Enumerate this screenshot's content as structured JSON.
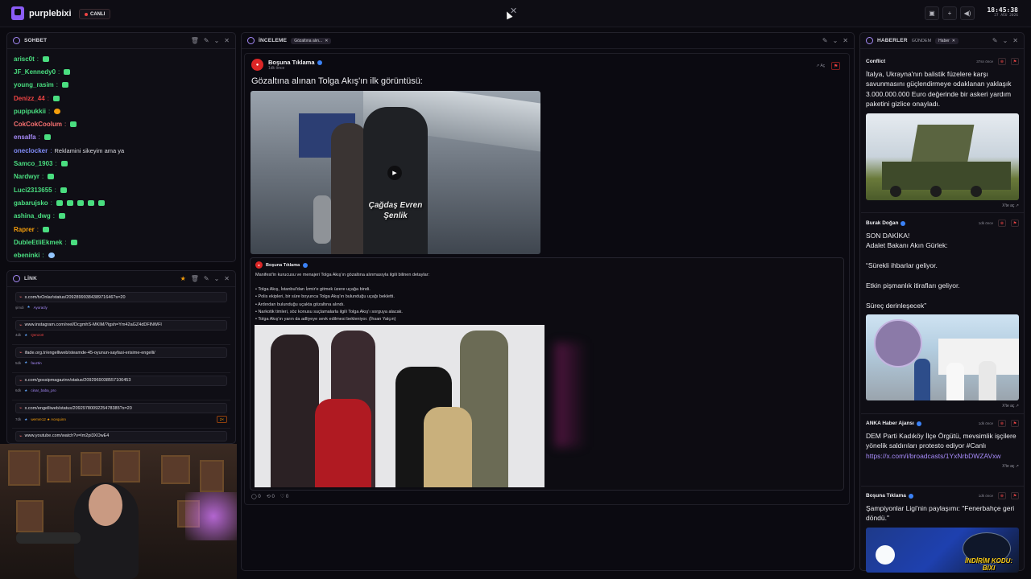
{
  "app": {
    "name": "purplebixi",
    "live_label": "CANLI",
    "time": "18:45:38",
    "date": "27 AĞU 2026"
  },
  "chat": {
    "title": "SOHBET",
    "messages": [
      {
        "user": "arisc0t",
        "color": "#4ade80",
        "msg": "",
        "emotes": 1
      },
      {
        "user": "JF_Kennedy0",
        "color": "#4ade80",
        "msg": "",
        "emotes": 1
      },
      {
        "user": "young_rasim",
        "color": "#4ade80",
        "msg": "",
        "emotes": 1
      },
      {
        "user": "Denizz_44",
        "color": "#ef4444",
        "msg": "",
        "emotes": 1
      },
      {
        "user": "pupipukkii",
        "color": "#4ade80",
        "msg": "",
        "emotes": 1
      },
      {
        "user": "CokCokCoolum",
        "color": "#f87171",
        "msg": "",
        "emotes": 1
      },
      {
        "user": "ensalfa",
        "color": "#a78bfa",
        "msg": "",
        "emotes": 1
      },
      {
        "user": "oneclocker",
        "color": "#818cf8",
        "msg": "Reklamini sikeyim ama ya",
        "emotes": 0
      },
      {
        "user": "Samco_1903",
        "color": "#4ade80",
        "msg": "",
        "emotes": 1
      },
      {
        "user": "Nardwyr",
        "color": "#4ade80",
        "msg": "",
        "emotes": 1
      },
      {
        "user": "Luci2313655",
        "color": "#4ade80",
        "msg": "",
        "emotes": 1
      },
      {
        "user": "gabarujsko",
        "color": "#4ade80",
        "msg": "",
        "emotes": 5
      },
      {
        "user": "ashina_dwg",
        "color": "#4ade80",
        "msg": "",
        "emotes": 1
      },
      {
        "user": "Raprer",
        "color": "#f59e0b",
        "msg": "",
        "emotes": 1
      },
      {
        "user": "DubleEtliEkmek",
        "color": "#4ade80",
        "msg": "",
        "emotes": 1
      },
      {
        "user": "ebeninki",
        "color": "#4ade80",
        "msg": "",
        "emotes": 1
      }
    ]
  },
  "links": {
    "title": "LİNK",
    "items": [
      {
        "url": "x.com/tvOnlar/status/2092899938438971646?s=20",
        "age": "şimdi",
        "by": "Ayoracly",
        "by_color": "#a78bfa",
        "badge": ""
      },
      {
        "url": "www.instagram.com/reel/DcgmhS-MKIM/?igsh=Ym42aGZ4dDFlNWFl",
        "age": "4dk",
        "by": "Qenzo0",
        "by_color": "#ef4444",
        "badge": ""
      },
      {
        "url": "ifade.org.tr/engelliweb/steamde-45-oyunun-sayfasi-erisime-engelli/",
        "age": "5dk",
        "by": "fauztin",
        "by_color": "#a78bfa",
        "badge": ""
      },
      {
        "url": "x.com/gossipmagazinn/status/2092969038557106453",
        "age": "6dk",
        "by": "cinar_baba_pro",
        "by_color": "#a78bfa",
        "badge": ""
      },
      {
        "url": "x.com/engelliweb/status/2092978009225478385?s=20",
        "age": "7dk",
        "by": "wemre12 ★ Acequinn",
        "by_color": "#f59e0b",
        "badge": "2×"
      },
      {
        "url": "www.youtube.com/watch?v=Im2pi3XOwE4",
        "age": "",
        "by": "",
        "by_color": "#a78bfa",
        "badge": ""
      }
    ]
  },
  "review": {
    "title": "İNCELEME",
    "chip": "Gözaltına alın...",
    "author": "Boşuna Tıklama",
    "time": "1dk önce",
    "text": "Gözaltına alınan Tolga Akış'ın ilk görüntüsü:",
    "open_label": "Aç",
    "video_caption": "Çağdaş Evren Şenlik",
    "quote_author": "Boşuna Tıklama",
    "quote_lines": [
      "Manifest'in kurucusu ve menajeri Tolga Akış'ın gözaltına alınmasıyla ilgili bilinen detaylar:",
      "",
      "• Tolga Akış, İstanbul'dan İzmir'e gitmek üzere uçağa bindi.",
      "• Polis ekipleri, bir süre boyunca Tolga Akış'ın bulunduğu uçağı bekletti.",
      "• Ardından bulunduğu uçakta gözaltına alındı.",
      "• Narkotik timleri, söz konusu suçlamalarla ilgili Tolga Akış'ı sorguya alacak.",
      "• Tolga Akış'ın yarın da adliyeye sevk edilmesi bekleniyor. (İhsan Yalçın)"
    ],
    "actions": {
      "replies": "0",
      "retweets": "0",
      "likes": "0"
    }
  },
  "news": {
    "title": "HABERLER",
    "tab_gundem": "GÜNDEM",
    "chip": "Haber",
    "open_label": "X'te aç",
    "items": [
      {
        "source": "Conflict",
        "verified": false,
        "time": "37sn önce",
        "text": "İtalya, Ukrayna'nın balistik füzelere karşı savunmasını güçlendirmeye odaklanan yaklaşık 3.000.000.000 Euro değerinde bir askeri yardım paketini gizlice onayladı."
      },
      {
        "source": "Burak Doğan",
        "verified": true,
        "time": "1dk önce",
        "text": "SON DAKİKA!\nAdalet Bakanı Akın Gürlek:\n\n“Sürekli ihbarlar geliyor.\n\nEtkin pişmanlık itirafları geliyor.\n\nSüreç derinleşecek”"
      },
      {
        "source": "ANKA Haber Ajansı",
        "verified": true,
        "time": "1dk önce",
        "text": "DEM Parti Kadıköy İlçe Örgütü, mevsimlik işçilere yönelik saldırıları protesto ediyor #Canlı ",
        "link": "https://x.com/i/broadcasts/1YxNrbDWZAVxw"
      },
      {
        "source": "Boşuna Tıklama",
        "verified": true,
        "time": "1dk önce",
        "text": "Şampiyonlar Ligi'nin paylaşımı: \"Fenerbahçe geri döndü.\""
      }
    ]
  },
  "promo": {
    "line1": "İNDİRİM KODU:",
    "line2": "BIXI"
  },
  "colors": {
    "accent": "#8b5cf6",
    "live": "#ef4444",
    "bg": "#0b0a10"
  }
}
